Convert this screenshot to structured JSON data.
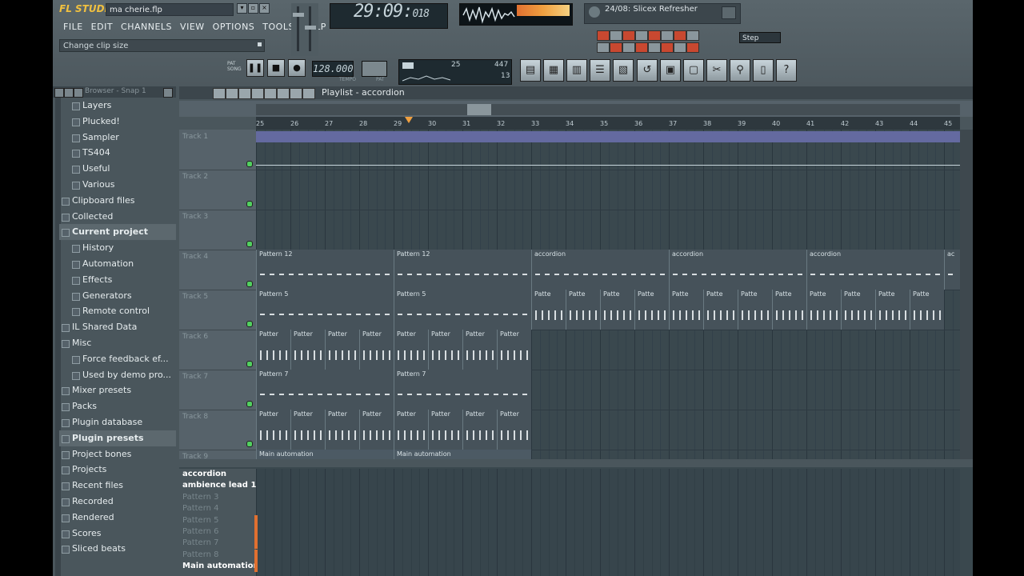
{
  "app": {
    "logo": "FL STUDIO",
    "project_file": "ma cherie.flp",
    "hint": "Change clip size"
  },
  "menu": [
    "FILE",
    "EDIT",
    "CHANNELS",
    "VIEW",
    "OPTIONS",
    "TOOLS",
    "HELP"
  ],
  "transport": {
    "time": "29:09:",
    "time_small": "018",
    "tempo": "128.000",
    "tempo_label": "TEMPO",
    "pat_label": "PAT",
    "pat_song": [
      "PAT",
      "SONG"
    ],
    "cpu_value": "25",
    "ram_value": "447",
    "poly_value": "13"
  },
  "plugin_hint": "24/08: Slicex Refresher",
  "snap_mode": "Step",
  "browser": {
    "header": "Browser - Snap 1",
    "items": [
      {
        "label": "Layers",
        "indent": 2
      },
      {
        "label": "Plucked!",
        "indent": 2
      },
      {
        "label": "Sampler",
        "indent": 2
      },
      {
        "label": "TS404",
        "indent": 2
      },
      {
        "label": "Useful",
        "indent": 2
      },
      {
        "label": "Various",
        "indent": 2
      },
      {
        "label": "Clipboard files",
        "indent": 1
      },
      {
        "label": "Collected",
        "indent": 1
      },
      {
        "label": "Current project",
        "indent": 1
      },
      {
        "label": "History",
        "indent": 2
      },
      {
        "label": "Automation",
        "indent": 2
      },
      {
        "label": "Effects",
        "indent": 2
      },
      {
        "label": "Generators",
        "indent": 2
      },
      {
        "label": "Remote control",
        "indent": 2
      },
      {
        "label": "IL Shared Data",
        "indent": 1
      },
      {
        "label": "Misc",
        "indent": 1
      },
      {
        "label": "Force feedback ef...",
        "indent": 2
      },
      {
        "label": "Used by demo pro...",
        "indent": 2
      },
      {
        "label": "Mixer presets",
        "indent": 1
      },
      {
        "label": "Packs",
        "indent": 1
      },
      {
        "label": "Plugin database",
        "indent": 1
      },
      {
        "label": "Plugin presets",
        "indent": 1
      },
      {
        "label": "Project bones",
        "indent": 1
      },
      {
        "label": "Projects",
        "indent": 1
      },
      {
        "label": "Recent files",
        "indent": 1
      },
      {
        "label": "Recorded",
        "indent": 1
      },
      {
        "label": "Rendered",
        "indent": 1
      },
      {
        "label": "Scores",
        "indent": 1
      },
      {
        "label": "Sliced beats",
        "indent": 1
      }
    ]
  },
  "playlist": {
    "title": "Playlist - accordion",
    "ruler": [
      "25",
      "26",
      "27",
      "28",
      "29",
      "30",
      "31",
      "32",
      "33",
      "34",
      "35",
      "36",
      "37",
      "38",
      "39",
      "40",
      "41",
      "42",
      "43",
      "44",
      "45"
    ],
    "tracks": [
      "Track 1",
      "Track 2",
      "Track 3",
      "Track 4",
      "Track 5",
      "Track 6",
      "Track 7",
      "Track 8",
      "Track 9"
    ],
    "clips": {
      "t4": [
        "Pattern 12",
        "Pattern 12",
        "accordion",
        "accordion",
        "accordion",
        "ac"
      ],
      "t5": [
        "Pattern 5",
        "Pattern 5",
        "Patte",
        "Patte",
        "Patte",
        "Patte",
        "Patte",
        "Patte",
        "Patte",
        "Patte",
        "Patte",
        "Patte",
        "Patte",
        "Patte"
      ],
      "t6": [
        "Patter",
        "Patter",
        "Patter",
        "Patter",
        "Patter",
        "Patter",
        "Patter",
        "Patter"
      ],
      "t7": [
        "Pattern 7",
        "Pattern 7"
      ],
      "t8": [
        "Patter",
        "Patter",
        "Patter",
        "Patter",
        "Patter",
        "Patter",
        "Patter",
        "Patter"
      ],
      "t9": [
        "Main automation",
        "Main automation"
      ]
    }
  },
  "picker": {
    "items": [
      "accordion",
      "ambience lead 1",
      "Pattern 3",
      "Pattern 4",
      "Pattern 5",
      "Pattern 6",
      "Pattern 7",
      "Pattern 8",
      "Main automation"
    ]
  }
}
